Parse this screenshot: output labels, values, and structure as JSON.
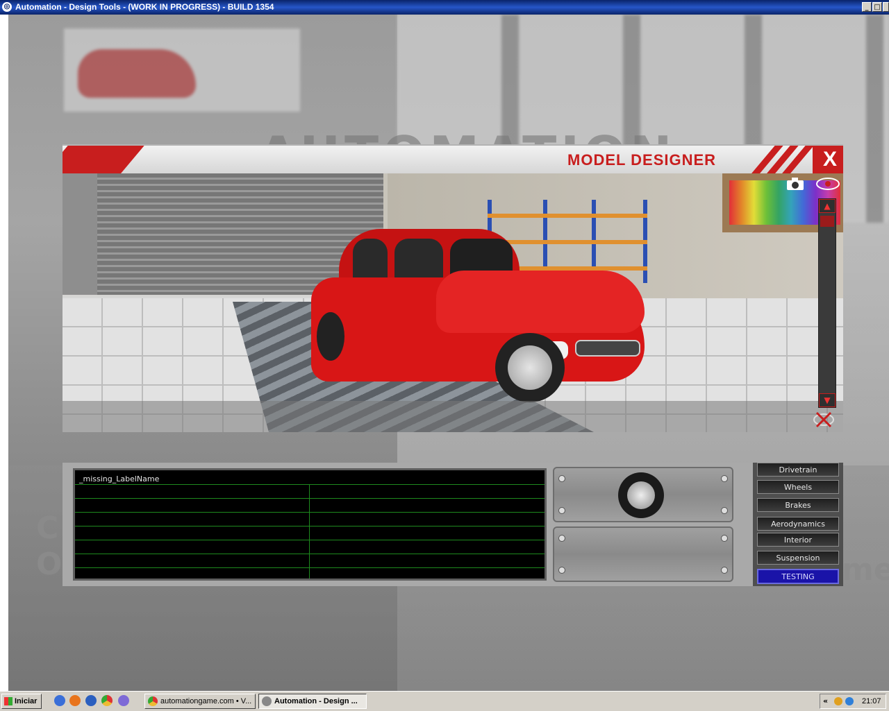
{
  "window": {
    "title": "Automation - Design Tools - (WORK IN PROGRESS) - BUILD 1354",
    "minimize": "_",
    "maximize": "□",
    "close": "✕"
  },
  "background": {
    "logo": "AUTOMATION",
    "text_left": "C\nO",
    "text_right": "me"
  },
  "designer": {
    "title": "MODEL DESIGNER",
    "close_label": "X",
    "camera_icon": "camera-icon",
    "eye_icon": "eye-icon",
    "scroll_up": "▲",
    "scroll_down": "▼",
    "hide_icon": "hide-icon"
  },
  "graph": {
    "label": "_missing_LabelName"
  },
  "tabs": [
    {
      "label": "Drivetrain",
      "active": false
    },
    {
      "label": "Wheels",
      "active": false
    },
    {
      "label": "Brakes",
      "active": false
    },
    {
      "label": "Aerodynamics",
      "active": false
    },
    {
      "label": "Interior",
      "active": false
    },
    {
      "label": "Suspension",
      "active": false
    },
    {
      "label": "TESTING",
      "active": true
    }
  ],
  "taskbar": {
    "start_label": "Iniciar",
    "tasks": [
      {
        "label": "automationgame.com • V...",
        "active": false
      },
      {
        "label": "Automation - Design ...",
        "active": true
      }
    ],
    "tray_chevron": "«",
    "clock": "21:07"
  },
  "colors": {
    "accent_red": "#c81e1e",
    "car_red": "#d81616",
    "active_tab": "#1a13a8"
  }
}
